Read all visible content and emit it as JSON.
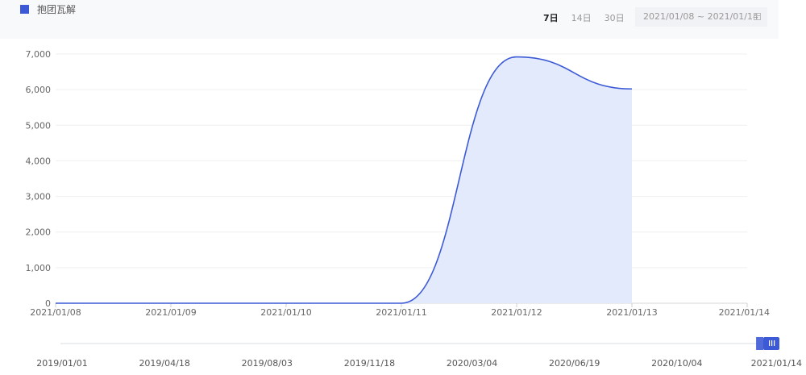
{
  "toolbar": {
    "legend_label": "抱团瓦解",
    "range_tabs": [
      "7日",
      "14日",
      "30日"
    ],
    "active_tab": 0,
    "date_range": "2021/01/08 ~ 2021/01/14"
  },
  "colors": {
    "line": "#3d5ad6",
    "area": "#e3eafc",
    "grid": "#efefef",
    "slider_handle": "#3d5ad6"
  },
  "icons": {
    "date_picker": "calendar-icon",
    "slider_handle": "grip-icon"
  },
  "chart_data": {
    "type": "area",
    "title": "",
    "xlabel": "",
    "ylabel": "",
    "categories": [
      "2021/01/08",
      "2021/01/09",
      "2021/01/10",
      "2021/01/11",
      "2021/01/12",
      "2021/01/13",
      "2021/01/14"
    ],
    "series": [
      {
        "name": "抱团瓦解",
        "values": [
          0,
          0,
          0,
          0,
          6920,
          6020,
          null
        ]
      }
    ],
    "ylim": [
      0,
      7000
    ],
    "yticks": [
      0,
      1000,
      2000,
      3000,
      4000,
      5000,
      6000,
      7000
    ],
    "ytick_labels": [
      "0",
      "1,000",
      "2,000",
      "3,000",
      "4,000",
      "5,000",
      "6,000",
      "7,000"
    ],
    "grid": true,
    "legend_position": "top-left"
  },
  "slider": {
    "labels": [
      "2019/01/01",
      "2019/04/18",
      "2019/08/03",
      "2019/11/18",
      "2020/03/04",
      "2020/06/19",
      "2020/10/04",
      "2021/01/14"
    ],
    "range_start": 0.99,
    "range_end": 1.0
  }
}
